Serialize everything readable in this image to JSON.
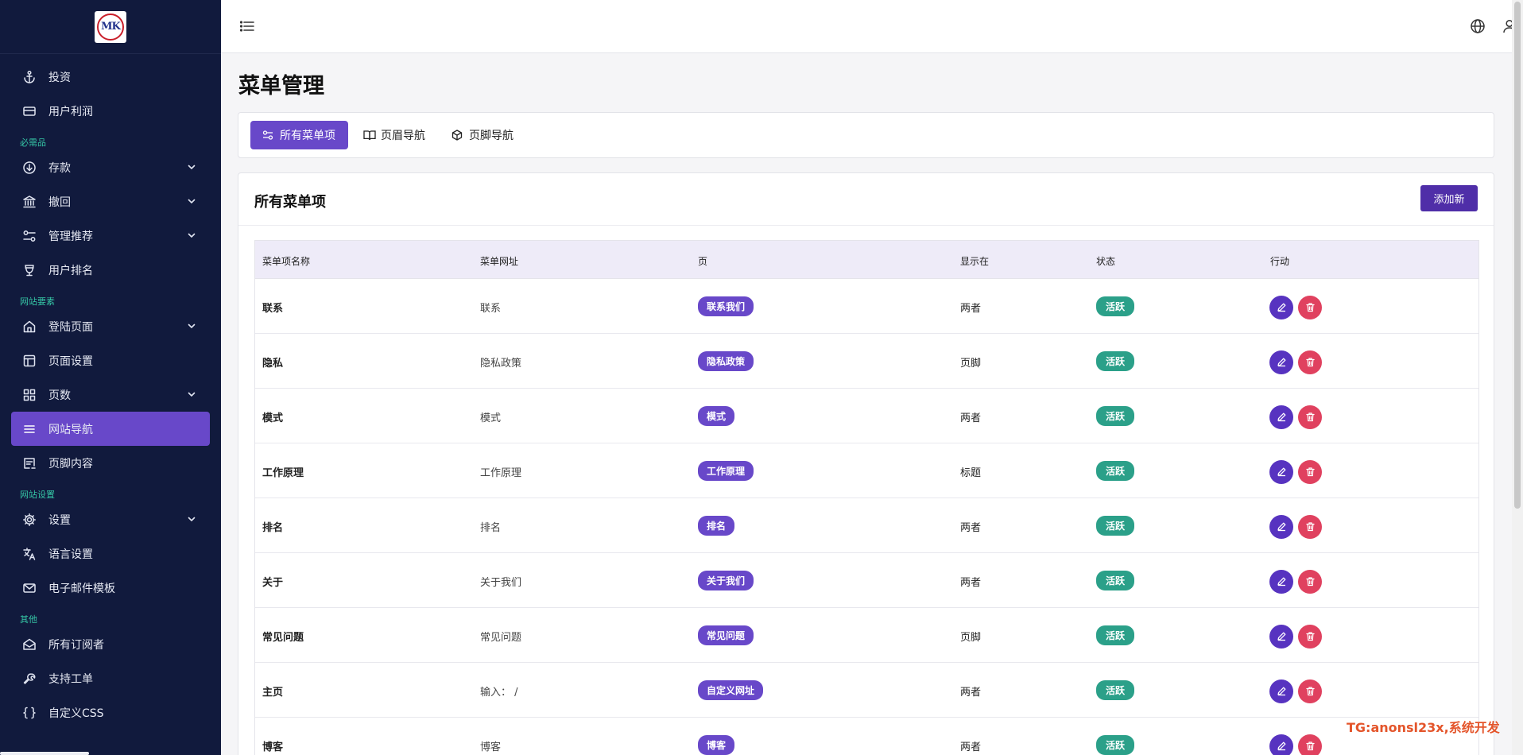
{
  "sidebar": {
    "logo_text": "MK",
    "items": [
      {
        "label": "投资",
        "icon": "anchor-icon"
      },
      {
        "label": "用户利润",
        "icon": "card-icon"
      },
      {
        "section": "必需品"
      },
      {
        "label": "存款",
        "icon": "arrow-down-circle-icon",
        "expandable": true
      },
      {
        "label": "撤回",
        "icon": "bank-icon",
        "expandable": true
      },
      {
        "label": "管理推荐",
        "icon": "sliders-icon",
        "expandable": true
      },
      {
        "label": "用户排名",
        "icon": "trophy-icon"
      },
      {
        "section": "网站要素"
      },
      {
        "label": "登陆页面",
        "icon": "home-icon",
        "expandable": true
      },
      {
        "label": "页面设置",
        "icon": "layout-icon"
      },
      {
        "label": "页数",
        "icon": "grid-icon",
        "expandable": true
      },
      {
        "label": "网站导航",
        "icon": "menu-icon",
        "active": true
      },
      {
        "label": "页脚内容",
        "icon": "footer-icon"
      },
      {
        "section": "网站设置"
      },
      {
        "label": "设置",
        "icon": "gear-icon",
        "expandable": true
      },
      {
        "label": "语言设置",
        "icon": "translate-icon"
      },
      {
        "label": "电子邮件模板",
        "icon": "mail-icon"
      },
      {
        "section": "其他"
      },
      {
        "label": "所有订阅者",
        "icon": "mail-open-icon"
      },
      {
        "label": "支持工单",
        "icon": "wrench-icon"
      },
      {
        "label": "自定义CSS",
        "icon": "braces-icon"
      }
    ]
  },
  "page": {
    "title": "菜单管理"
  },
  "tabs": {
    "all": "所有菜单项",
    "header": "页眉导航",
    "footer": "页脚导航"
  },
  "card": {
    "title": "所有菜单项",
    "add_button": "添加新"
  },
  "table": {
    "headers": [
      "菜单项名称",
      "菜单网址",
      "页",
      "显示在",
      "状态",
      "行动"
    ],
    "rows": [
      {
        "name": "联系",
        "url": "联系",
        "page": "联系我们",
        "show": "两者",
        "status": "活跃"
      },
      {
        "name": "隐私",
        "url": "隐私政策",
        "page": "隐私政策",
        "show": "页脚",
        "status": "活跃"
      },
      {
        "name": "模式",
        "url": "模式",
        "page": "模式",
        "show": "两者",
        "status": "活跃"
      },
      {
        "name": "工作原理",
        "url": "工作原理",
        "page": "工作原理",
        "show": "标题",
        "status": "活跃"
      },
      {
        "name": "排名",
        "url": "排名",
        "page": "排名",
        "show": "两者",
        "status": "活跃"
      },
      {
        "name": "关于",
        "url": "关于我们",
        "page": "关于我们",
        "show": "两者",
        "status": "活跃"
      },
      {
        "name": "常见问题",
        "url": "常见问题",
        "page": "常见问题",
        "show": "页脚",
        "status": "活跃"
      },
      {
        "name": "主页",
        "url": "输入： /",
        "page": "自定义网址",
        "show": "两者",
        "status": "活跃"
      },
      {
        "name": "博客",
        "url": "博客",
        "page": "博客",
        "show": "两者",
        "status": "活跃"
      }
    ]
  },
  "watermark": "TG:anonsl23x,系统开发",
  "colors": {
    "sidebar_bg": "#111a3d",
    "accent": "#6848c9",
    "section_label": "#35c5a5",
    "status_active": "#2ba089",
    "delete": "#e0415f"
  }
}
